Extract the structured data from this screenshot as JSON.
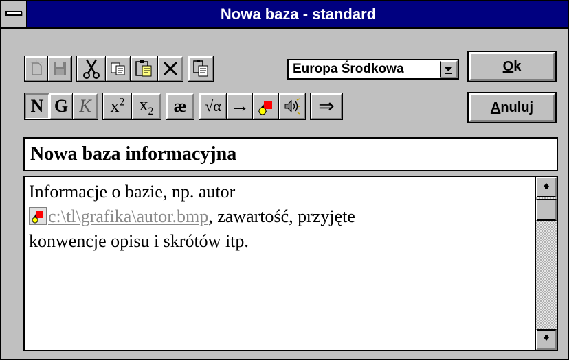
{
  "window": {
    "title": "Nowa baza - standard"
  },
  "toolbar": {
    "format_buttons": {
      "normal": "N",
      "bold": "G",
      "italic": "K",
      "superscript_base": "x",
      "superscript_exp": "2",
      "subscript_base": "x",
      "subscript_idx": "2",
      "ligature": "æ",
      "math": "√α",
      "arrow": "→",
      "link_arrow": "⇒"
    },
    "region_select": {
      "value": "Europa Środkowa"
    }
  },
  "dialog_buttons": {
    "ok_accel": "O",
    "ok_rest": "k",
    "cancel_accel": "A",
    "cancel_rest": "nuluj"
  },
  "database": {
    "name": "Nowa baza informacyjna",
    "description": {
      "line1": "Informacje o bazie, np. autor",
      "image_path": "c:\\tl\\grafika\\autor.bmp",
      "line2_rest": ", zawartość, przyjęte",
      "line3": "konwencje opisu i skrótów itp."
    }
  },
  "icons": [
    "system-menu-icon",
    "new-document-icon",
    "save-icon",
    "cut-icon",
    "copy-icon",
    "paste-icon",
    "delete-icon",
    "paste-special-icon",
    "insert-picture-icon",
    "insert-sound-icon",
    "dropdown-arrow-icon",
    "scroll-up-icon",
    "scroll-down-icon"
  ],
  "colors": {
    "titlebar": "#000080",
    "face": "#c0c0c0",
    "link_text": "#8a8a8a"
  }
}
